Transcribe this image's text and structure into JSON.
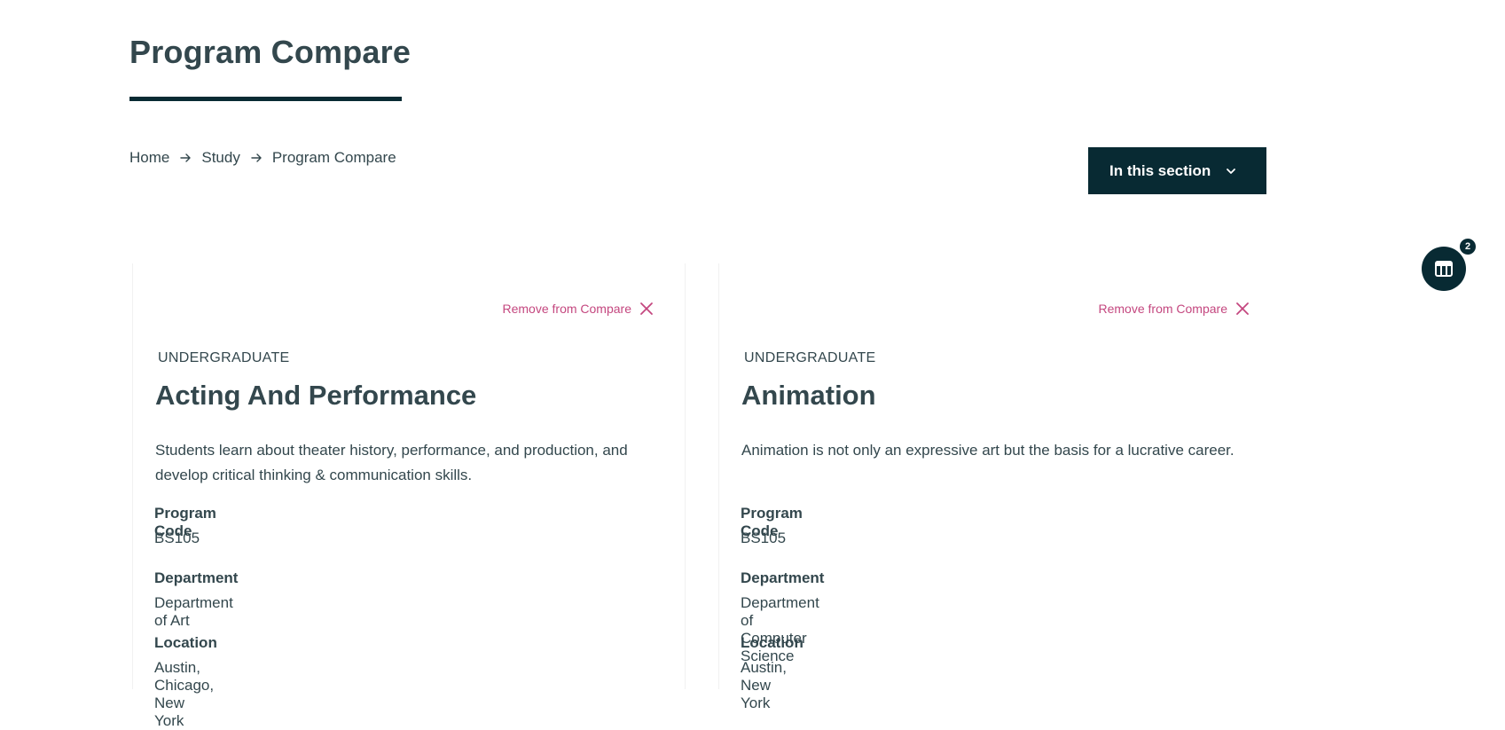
{
  "page": {
    "title": "Program Compare"
  },
  "breadcrumb": {
    "items": [
      "Home",
      "Study",
      "Program Compare"
    ]
  },
  "section_menu": {
    "label": "In this section"
  },
  "compare_widget": {
    "count": "2"
  },
  "programs": [
    {
      "remove_label": "Remove from Compare",
      "level": "UNDERGRADUATE",
      "name": "Acting And Performance",
      "description": "Students learn about theater history, performance, and production, and develop critical thinking & communication skills.",
      "program_code_label": "Program Code",
      "program_code": "BS105",
      "department_label": "Department",
      "department": "Department of Art",
      "location_label": "Location",
      "location": "Austin, Chicago, New York"
    },
    {
      "remove_label": "Remove from Compare",
      "level": "UNDERGRADUATE",
      "name": "Animation",
      "description": "Animation is not only an expressive art but the basis for a lucrative career.",
      "program_code_label": "Program Code",
      "program_code": "BS105",
      "department_label": "Department",
      "department": "Department of Computer Science",
      "location_label": "Location",
      "location": "Austin, New York"
    }
  ],
  "colors": {
    "primary_dark": "#082a33",
    "text": "#33474d",
    "accent_pink": "#c4477f"
  }
}
